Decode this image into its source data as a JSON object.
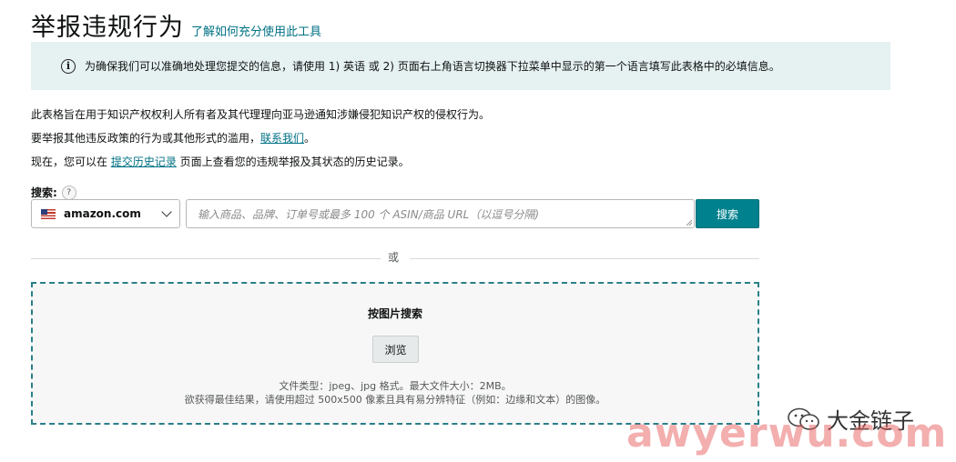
{
  "header": {
    "title": "举报违规行为",
    "help_link": "了解如何充分使用此工具"
  },
  "notice": {
    "icon": "info-icon",
    "text": "为确保我们可以准确地处理您提交的信息，请使用 1) 英语 或 2) 页面右上角语言切换器下拉菜单中显示的第一个语言填写此表格中的必填信息。"
  },
  "intro": {
    "line1": "此表格旨在用于知识产权权利人所有者及其代理理向亚马逊通知涉嫌侵犯知识产权的侵权行为。",
    "line2_prefix": "要举报其他违反政策的行为或其他形式的滥用，",
    "line2_link": "联系我们",
    "line2_suffix": "。",
    "line3_prefix": "现在，您可以在 ",
    "line3_link": "提交历史记录",
    "line3_suffix": " 页面上查看您的违规举报及其状态的历史记录。"
  },
  "search": {
    "label": "搜索:",
    "help_icon": "?",
    "marketplace": "amazon.com",
    "placeholder": "输入商品、品牌、订单号或最多 100 个 ASIN/商品 URL（以逗号分隔)",
    "button": "搜索"
  },
  "separator": "或",
  "image_search": {
    "title": "按图片搜索",
    "browse_button": "浏览",
    "hint1": "文件类型：jpeg、jpg 格式。最大文件大小：2MB。",
    "hint2": "欲获得最佳结果，请使用超过 500x500 像素且具有易分辨特征（例如：边缘和文本）的图像。"
  },
  "watermark": {
    "brand": "大金链子",
    "url": "awyerwu.com"
  },
  "colors": {
    "accent": "#00828e",
    "link": "#007185",
    "notice_bg": "#e6f1f1",
    "dash_border": "#2a7f89"
  }
}
